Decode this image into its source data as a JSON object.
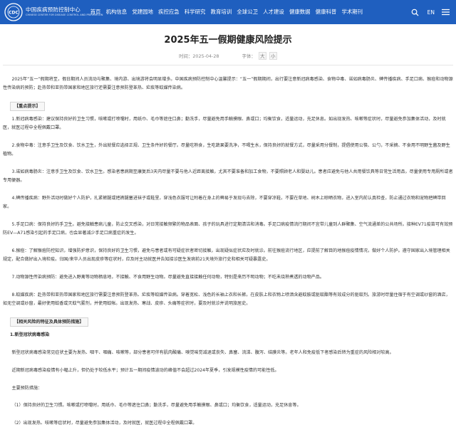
{
  "header": {
    "logo_cn": "中国疾病预防控制中心",
    "logo_en": "CHINESE CENTER FOR DISEASE CONTROL AND PREVENTION",
    "nav": [
      "首页",
      "机构信息",
      "党建园地",
      "疾控应急",
      "科学研究",
      "教育培训",
      "全球公卫",
      "人才建设",
      "健康数据",
      "健康科普",
      "学术期刊"
    ],
    "lang": "EN",
    "colors": {
      "bar": "#1f5fbf"
    },
    "icons": [
      "search-icon",
      "menu-icon"
    ]
  },
  "article": {
    "title": "2025年五一假期健康风险提示",
    "time_label": "时间：",
    "time": "2025-04-28",
    "font_label": "字体：",
    "font_large": "大",
    "font_small": "小",
    "intro": "2025年“五一”假期将至，假日期间人员流动与聚集、境内游、出境游将会明显增多。中国疾病预防控制中心温馨提示：“五一”假期期间，出行要注意新冠病毒感染、食物中毒、诺如病毒肠炎、蜱传播疾病、手足口病、猴痘和动物源性传染病的预防；赴热带和亚热带国家和地区旅行还需要注意预防登革热、疟疾等蚊媒传染病。",
    "key_title": "【重点提示】",
    "tips": [
      "1.新冠病毒感染：建议保持良好的卫生习惯，咳嗽或打喷嚏时，用纸巾、毛巾等遮住口鼻；勤洗手，尽量避免用手触摸眼、鼻或口；均衡饮食，适量运动，充足休息。如出现发热、咳嗽等症状时，尽量避免参加集体活动，及时就医，就医过程中全程佩戴口罩。",
      "2.食物中毒：注意手卫生及饮食、饮水卫生，外出就餐应选择正规、卫生条件好的餐厅。尽量吃熟食，生吃蔬果要洗净，不喝生水，保持良好的就餐方式，尽量采用分餐制，提倡使用公筷、公勺，不采摘、不食用不明野生菌及野生植物。",
      "3.诺如病毒肠炎：注意手卫生及饮食、饮水卫生。感染者患病期至康复后3天内尽量不要与他人近距离接触，尤其不要准备和加工食物，不要照顾老人和婴幼儿。患者应避免与他人共用餐饮具等日常生活用品，尽量使用专用厕所或者专用便器。",
      "4.蜱传播疾病：野外活动时做好个人防护，扎紧裤腿或把裤腿塞进袜子或鞋里，穿浅色衣服可让附着在身上的蜱易于发现与去除，不要穿凉鞋，不要在草地、树木上晾晒衣物，进入室内前认真检查，防止通过衣物和宠物把蜱带回家。",
      "5.手足口病：保持良好的手卫生。避免接触患病儿童，防止交叉感染，对日常接触频繁的物品表面、孩子的玩具进行定期清洁和消毒。手足口病疫情流行期间不宜带儿童到人群聚集、空气流通差的公共场所。接种EV71疫苗可有效预防EV—A71感染引起的手足口病，也会显著减少手足口病重症的发生。",
      "6.猴痘：了解猴痘防控知识，增强防护意识，保持良好的卫生习惯，避免与患者或有可疑症状者密切接触，出现疑似症状应及时就诊。前往猴痘流行地区，应提前了解目的地猴痘疫情情况，做好个人防护。遵守国家出入境管理相关规定，配合做好出入境检疫。归国/来华人员出现皮疹等症状时，应及时主动就医并告知接诊医生发病前21天境外旅行史和相关可疑暴露史。",
      "7.动物源性传染病预防：避免进入野禽等动物栖息地，不接触、不食用野生动物。尽量避免直接接触任何动物，特别是来历不明动物；不吃未烧熟煮透的动物产品。",
      "8.蚊媒疾病：赴热带和亚热带国家和地区旅行需要注意预防登革热、疟疾等蚊媒传染病。穿着宽松、浅色的长袖上衣和长裤。在皮肤上和衣物上喷洒含避蚊胺或驱蚊酯等有效成分的驱蚊剂。旅游时尽量住宿于有空调或纱窗的酒店，如无空调或纱窗，最好使用蚊香或灭蚊气雾剂，并使用蚊帐。出现发热、寒战、皮疹、头痛等症状时，要及时就诊并说明旅居史。"
    ],
    "related_title": "【相关风险的特征及具体预防措施】",
    "section1_title": "1.新型冠状病毒感染",
    "section1_p1": "新型冠状病毒感染常见症状主要为发热、咽干、咽痛、咳嗽等，部分患者可伴有肌肉酸痛、嗅觉味觉减退或丧失、鼻塞、流涕、腹泻、结膜炎等。老年人和免疫低下者感染后转为重症的风险相对较高。",
    "section1_p2": "近期新冠病毒感染疫情有小幅上升，但仍处于较低水平；预计五一期间疫情波动的峰值不会超过2024年夏季，引发规模性疫情的可能性低。",
    "measures_label": "主要预防措施：",
    "m1": "（1）保持良好的卫生习惯。咳嗽或打喷嚏时，用纸巾、毛巾等遮住口鼻；勤洗手，尽量避免用手触摸眼、鼻或口；均衡饮食，适量运动，充足休息等。",
    "m2": "（2）出现发热、咳嗽等症状时，尽量避免参加集体活动，及时就医，就医过程中全程佩戴口罩。"
  }
}
